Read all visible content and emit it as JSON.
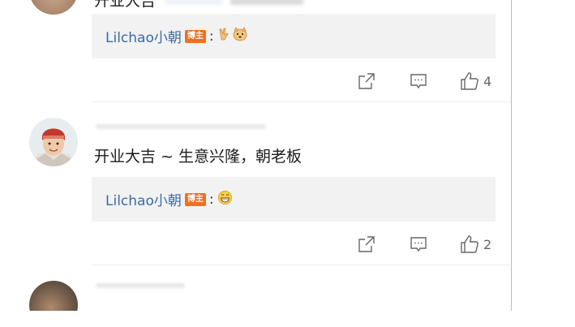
{
  "comments": [
    {
      "text": "开业大吉",
      "reply": {
        "author": "Lilchao小朝",
        "badge": "博主",
        "colon": ":",
        "emoji": [
          "victory-hand-icon",
          "dog-face-icon"
        ]
      },
      "likes": "4"
    },
    {
      "text": "开业大吉 ~ 生意兴隆，朝老板",
      "reply": {
        "author": "Lilchao小朝",
        "badge": "博主",
        "colon": ":",
        "emoji": [
          "grinning-face-icon"
        ]
      },
      "likes": "2"
    }
  ],
  "colors": {
    "reply_author": "#3b6aa8",
    "badge": "#f07022",
    "divider": "#ececec"
  }
}
